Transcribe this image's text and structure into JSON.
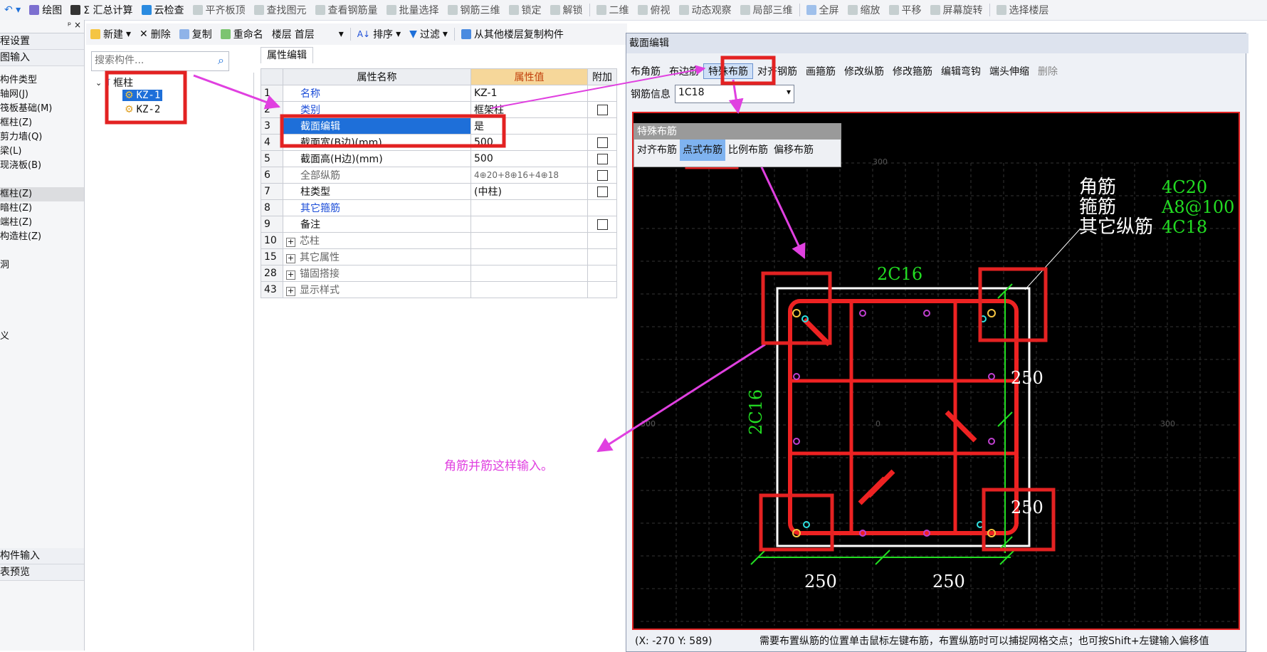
{
  "toolbar_main": {
    "items": [
      {
        "label": "绘图",
        "icon": "draw-icon"
      },
      {
        "label": "Σ 汇总计算",
        "icon": "sum-icon"
      },
      {
        "label": "云检查",
        "icon": "cloud-check-icon"
      },
      {
        "label": "平齐板顶",
        "icon": "align-slab-icon"
      },
      {
        "label": "查找图元",
        "icon": "find-icon"
      },
      {
        "label": "查看钢筋量",
        "icon": "rebar-qty-icon"
      },
      {
        "label": "批量选择",
        "icon": "batch-select-icon"
      },
      {
        "label": "钢筋三维",
        "icon": "rebar-3d-icon"
      },
      {
        "label": "锁定",
        "icon": "lock-icon"
      },
      {
        "label": "解锁",
        "icon": "unlock-icon"
      },
      {
        "label": "二维",
        "icon": "2d-icon"
      },
      {
        "label": "俯视",
        "icon": "top-view-icon"
      },
      {
        "label": "动态观察",
        "icon": "orbit-icon"
      },
      {
        "label": "局部三维",
        "icon": "local-3d-icon"
      },
      {
        "label": "全屏",
        "icon": "fullscreen-icon"
      },
      {
        "label": "缩放",
        "icon": "zoom-icon"
      },
      {
        "label": "平移",
        "icon": "pan-icon"
      },
      {
        "label": "屏幕旋转",
        "icon": "rotate-icon"
      },
      {
        "label": "选择楼层",
        "icon": "floor-select-icon"
      }
    ]
  },
  "toolbar_second": {
    "new": "新建",
    "delete": "删除",
    "copy": "复制",
    "rename": "重命名",
    "floor_label": "楼层",
    "floor_value": "首层",
    "sort": "排序",
    "filter": "过滤",
    "copy_from_floor": "从其他楼层复制构件"
  },
  "left_panel": {
    "pin": "ᵖ ×",
    "items": [
      "程设置",
      "图输入"
    ],
    "tree": [
      "构件类型",
      "轴网(J)",
      "筏板基础(M)",
      "框柱(Z)",
      "剪力墙(Q)",
      "梁(L)",
      "现浇板(B)",
      "",
      "框柱(Z)",
      "暗柱(Z)",
      "端柱(Z)",
      "构造柱(Z)",
      "",
      "洞",
      "",
      "",
      "",
      "",
      "义"
    ],
    "bottom_items": [
      "构件输入",
      "表预览"
    ]
  },
  "search": {
    "placeholder": "搜索构件..."
  },
  "tree": {
    "root": "框柱",
    "children": [
      "KZ-1",
      "KZ-2"
    ]
  },
  "properties": {
    "tab": "属性编辑",
    "headers": [
      "属性名称",
      "属性值",
      "附加"
    ],
    "rows": [
      {
        "n": "1",
        "name": "名称",
        "value": "KZ-1",
        "check": false,
        "style": "blue"
      },
      {
        "n": "2",
        "name": "类别",
        "value": "框架柱",
        "check": true,
        "style": "blue"
      },
      {
        "n": "3",
        "name": "截面编辑",
        "value": "是",
        "check": false,
        "style": "hl"
      },
      {
        "n": "4",
        "name": "截面宽(B边)(mm)",
        "value": "500",
        "check": true,
        "style": ""
      },
      {
        "n": "5",
        "name": "截面高(H边)(mm)",
        "value": "500",
        "check": true,
        "style": ""
      },
      {
        "n": "6",
        "name": "全部纵筋",
        "value": "4⊕20+8⊕16+4⊕18",
        "check": true,
        "style": "gray"
      },
      {
        "n": "7",
        "name": "柱类型",
        "value": "(中柱)",
        "check": true,
        "style": ""
      },
      {
        "n": "8",
        "name": "其它箍筋",
        "value": "",
        "check": false,
        "style": "blue"
      },
      {
        "n": "9",
        "name": "备注",
        "value": "",
        "check": true,
        "style": ""
      },
      {
        "n": "10",
        "name": "芯柱",
        "value": "",
        "check": false,
        "style": "plus"
      },
      {
        "n": "15",
        "name": "其它属性",
        "value": "",
        "check": false,
        "style": "plus"
      },
      {
        "n": "28",
        "name": "锚固搭接",
        "value": "",
        "check": false,
        "style": "plus"
      },
      {
        "n": "43",
        "name": "显示样式",
        "value": "",
        "check": false,
        "style": "plus"
      }
    ]
  },
  "annotation_text": "角筋并筋这样输入。",
  "dialog": {
    "title": "截面编辑",
    "toolbar": [
      "布角筋",
      "布边筋",
      "特殊布筋",
      "对齐钢筋",
      "画箍筋",
      "修改纵筋",
      "修改箍筋",
      "编辑弯钩",
      "端头伸缩",
      "删除"
    ],
    "info_label": "钢筋信息",
    "info_value": "1C18",
    "popup_title": "特殊布筋",
    "popup_items": [
      "对齐布筋",
      "点式布筋",
      "比例布筋",
      "偏移布筋"
    ],
    "status_coords": "(X: -270 Y: 589)",
    "status_hint": "需要布置纵筋的位置单击鼠标左键布筋，布置纵筋时可以捕捉网格交点；也可按Shift+左键输入偏移值"
  },
  "section": {
    "legend": [
      {
        "label": "角筋",
        "value": "4C20"
      },
      {
        "label": "箍筋",
        "value": "A8@100"
      },
      {
        "label": "其它纵筋",
        "value": "4C18"
      }
    ],
    "top_label": "2C16",
    "left_label": "2C16",
    "dims_right": [
      "250",
      "250"
    ],
    "dims_bottom": [
      "250",
      "250"
    ],
    "grid_labels": [
      "300",
      "300",
      "0",
      "300"
    ]
  },
  "colors": {
    "accent_red": "#e32222",
    "annotation_magenta": "#e040e0",
    "rebar_red": "#ee2222",
    "dim_green": "#22dd22",
    "selection_blue": "#1e6fd9"
  }
}
